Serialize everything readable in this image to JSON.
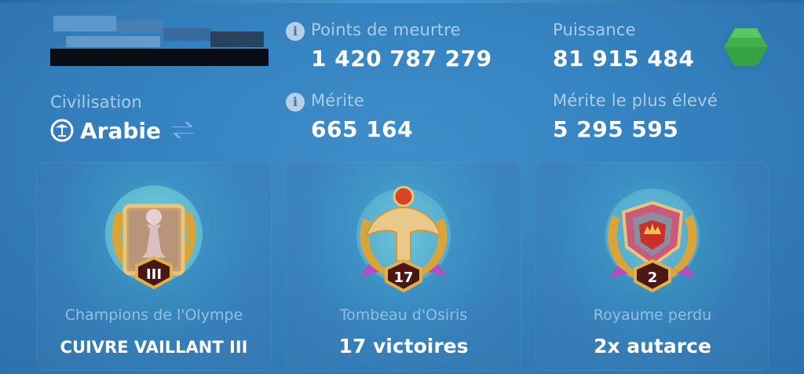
{
  "player": {
    "name_obscured": true
  },
  "civilization": {
    "label": "Civilisation",
    "value": "Arabie",
    "icon": "palm-icon",
    "swap_icon": "swap-arrows-icon"
  },
  "stats": {
    "kill_points": {
      "label": "Points de meurtre",
      "value": "1 420 787 279",
      "icon": "info-icon"
    },
    "power": {
      "label": "Puissance",
      "value": "81 915 484"
    },
    "merit": {
      "label": "Mérite",
      "value": "665 164",
      "icon": "info-icon"
    },
    "highest_merit": {
      "label": "Mérite le plus élevé",
      "value": "5 295 595"
    }
  },
  "power_gem_icon": "green-hexagon-gem-icon",
  "cards": [
    {
      "title": "Champions de l'Olympe",
      "value": "CUIVRE VAILLANT III",
      "badge_icon": "pawn-laurel-badge-icon",
      "badge_text": "III"
    },
    {
      "title": "Tombeau d'Osiris",
      "value": "17 victoires",
      "badge_icon": "falcon-laurel-badge-icon",
      "badge_text": "17"
    },
    {
      "title": "Royaume perdu",
      "value": "2x autarce",
      "badge_icon": "crown-shield-laurel-badge-icon",
      "badge_text": "2"
    }
  ],
  "colors": {
    "background": "#3582c0",
    "label": "#a9cdee",
    "value": "#ffffff",
    "gem": "#3fb04a"
  }
}
